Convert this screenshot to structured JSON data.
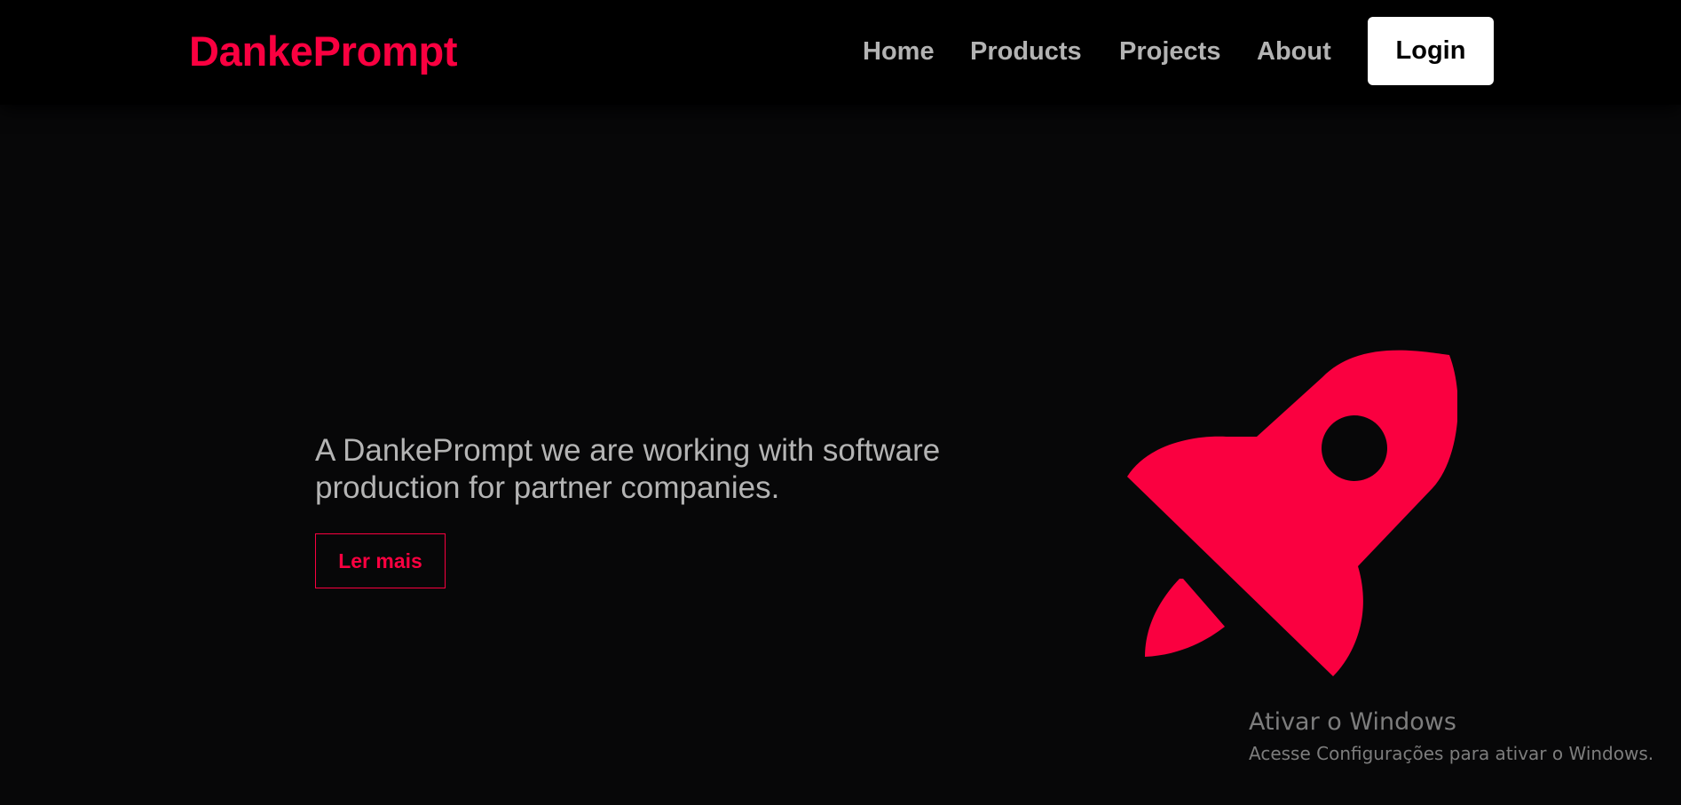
{
  "brand": {
    "name": "DankePrompt",
    "accent_color": "#fa0040"
  },
  "nav": {
    "items": [
      {
        "label": "Home"
      },
      {
        "label": "Products"
      },
      {
        "label": "Projects"
      },
      {
        "label": "About"
      }
    ],
    "login_label": "Login"
  },
  "hero": {
    "line1": "A DankePrompt we are working with software",
    "line2": "production for partner companies.",
    "cta_label": "Ler mais",
    "illustration": "rocket-icon"
  },
  "os_watermark": {
    "title": "Ativar o Windows",
    "subtitle": "Acesse Configurações para ativar o Windows."
  }
}
